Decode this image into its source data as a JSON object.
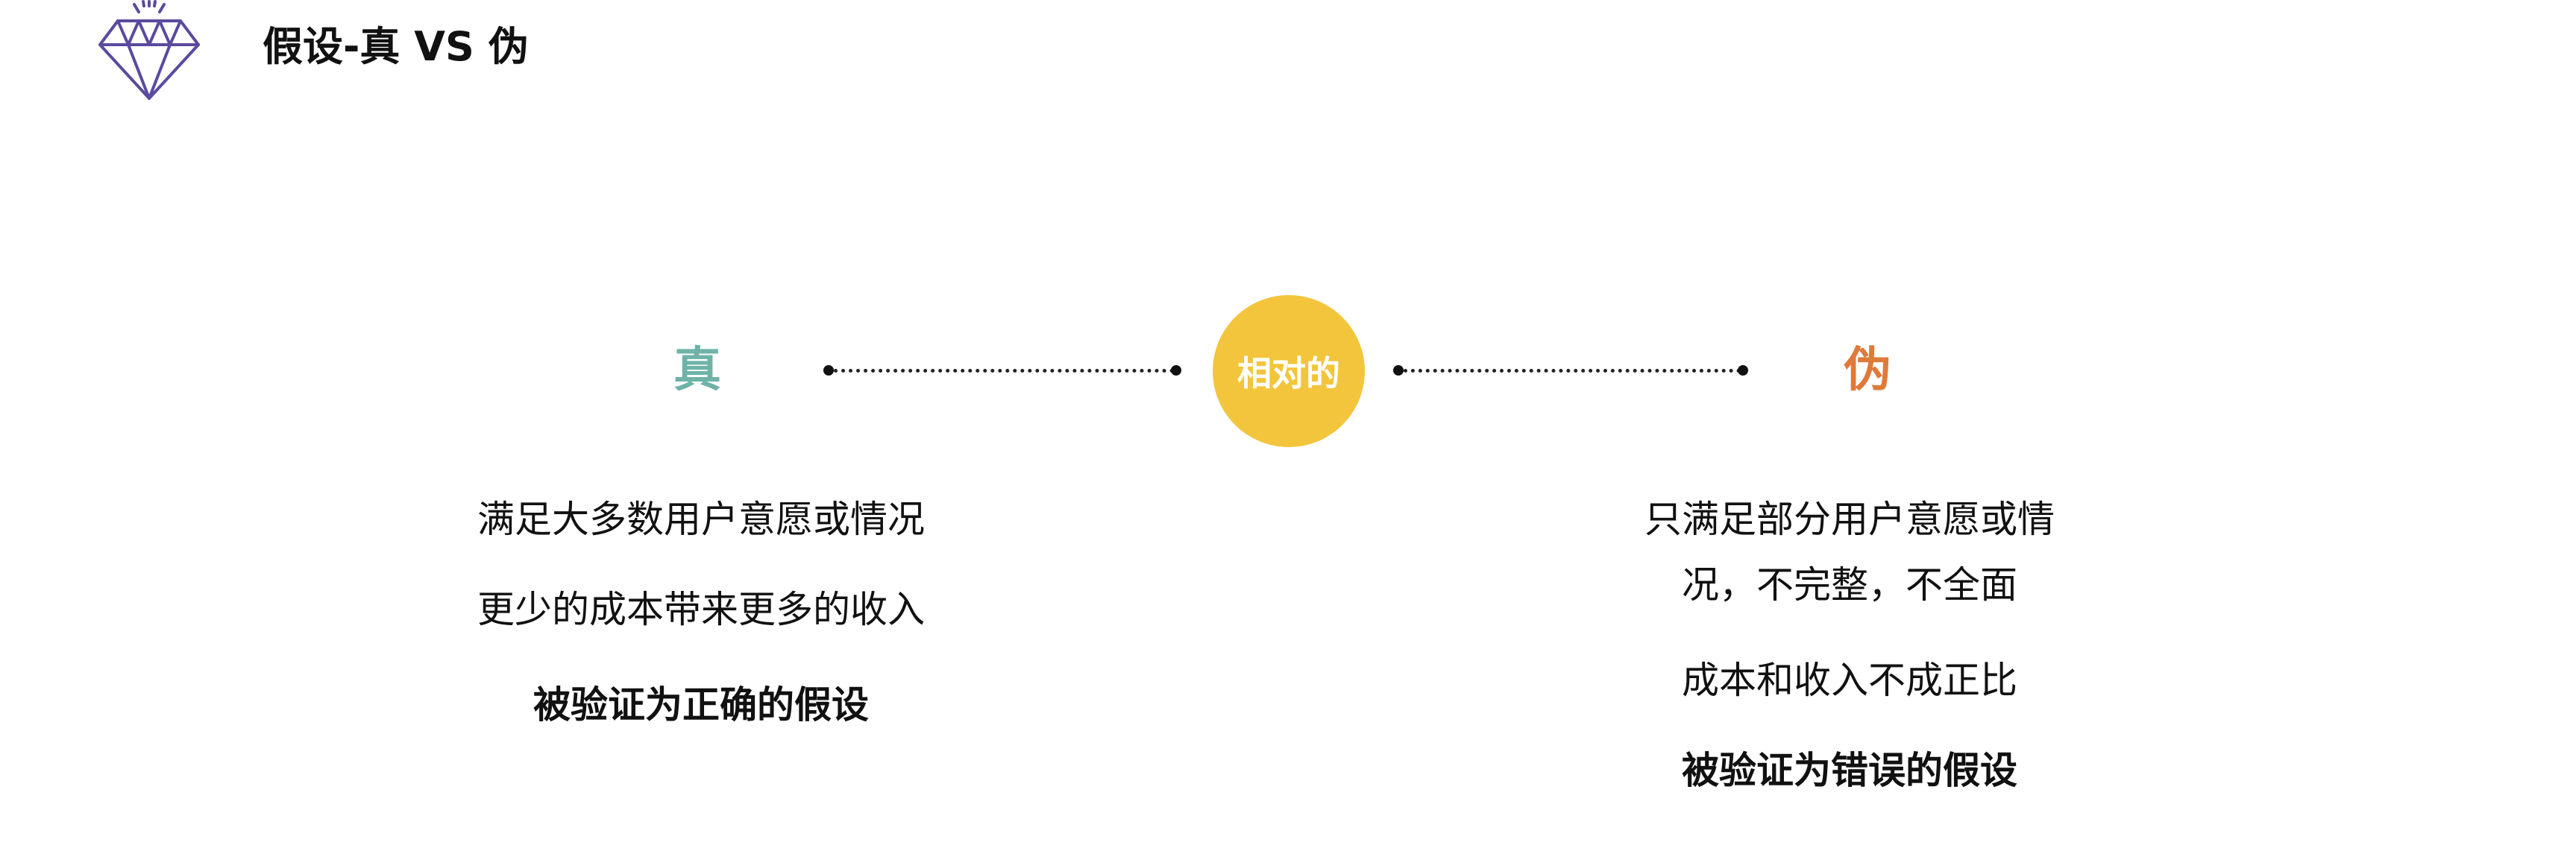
{
  "header": {
    "title": "假设-真 VS 伪",
    "icon": "diamond-icon"
  },
  "comparison": {
    "true_label": "真",
    "false_label": "伪",
    "center_label": "相对的",
    "true_points": [
      "满足大多数用户意愿或情况",
      "更少的成本带来更多的收入",
      "被验证为正确的假设"
    ],
    "false_points": [
      "只满足部分用户意愿或情",
      "况，不完整，不全面",
      "成本和收入不成正比",
      "被验证为错误的假设"
    ]
  },
  "colors": {
    "true": "#6fb3a8",
    "false": "#e07a3a",
    "center": "#f2c53d",
    "icon": "#5b4a9e"
  }
}
